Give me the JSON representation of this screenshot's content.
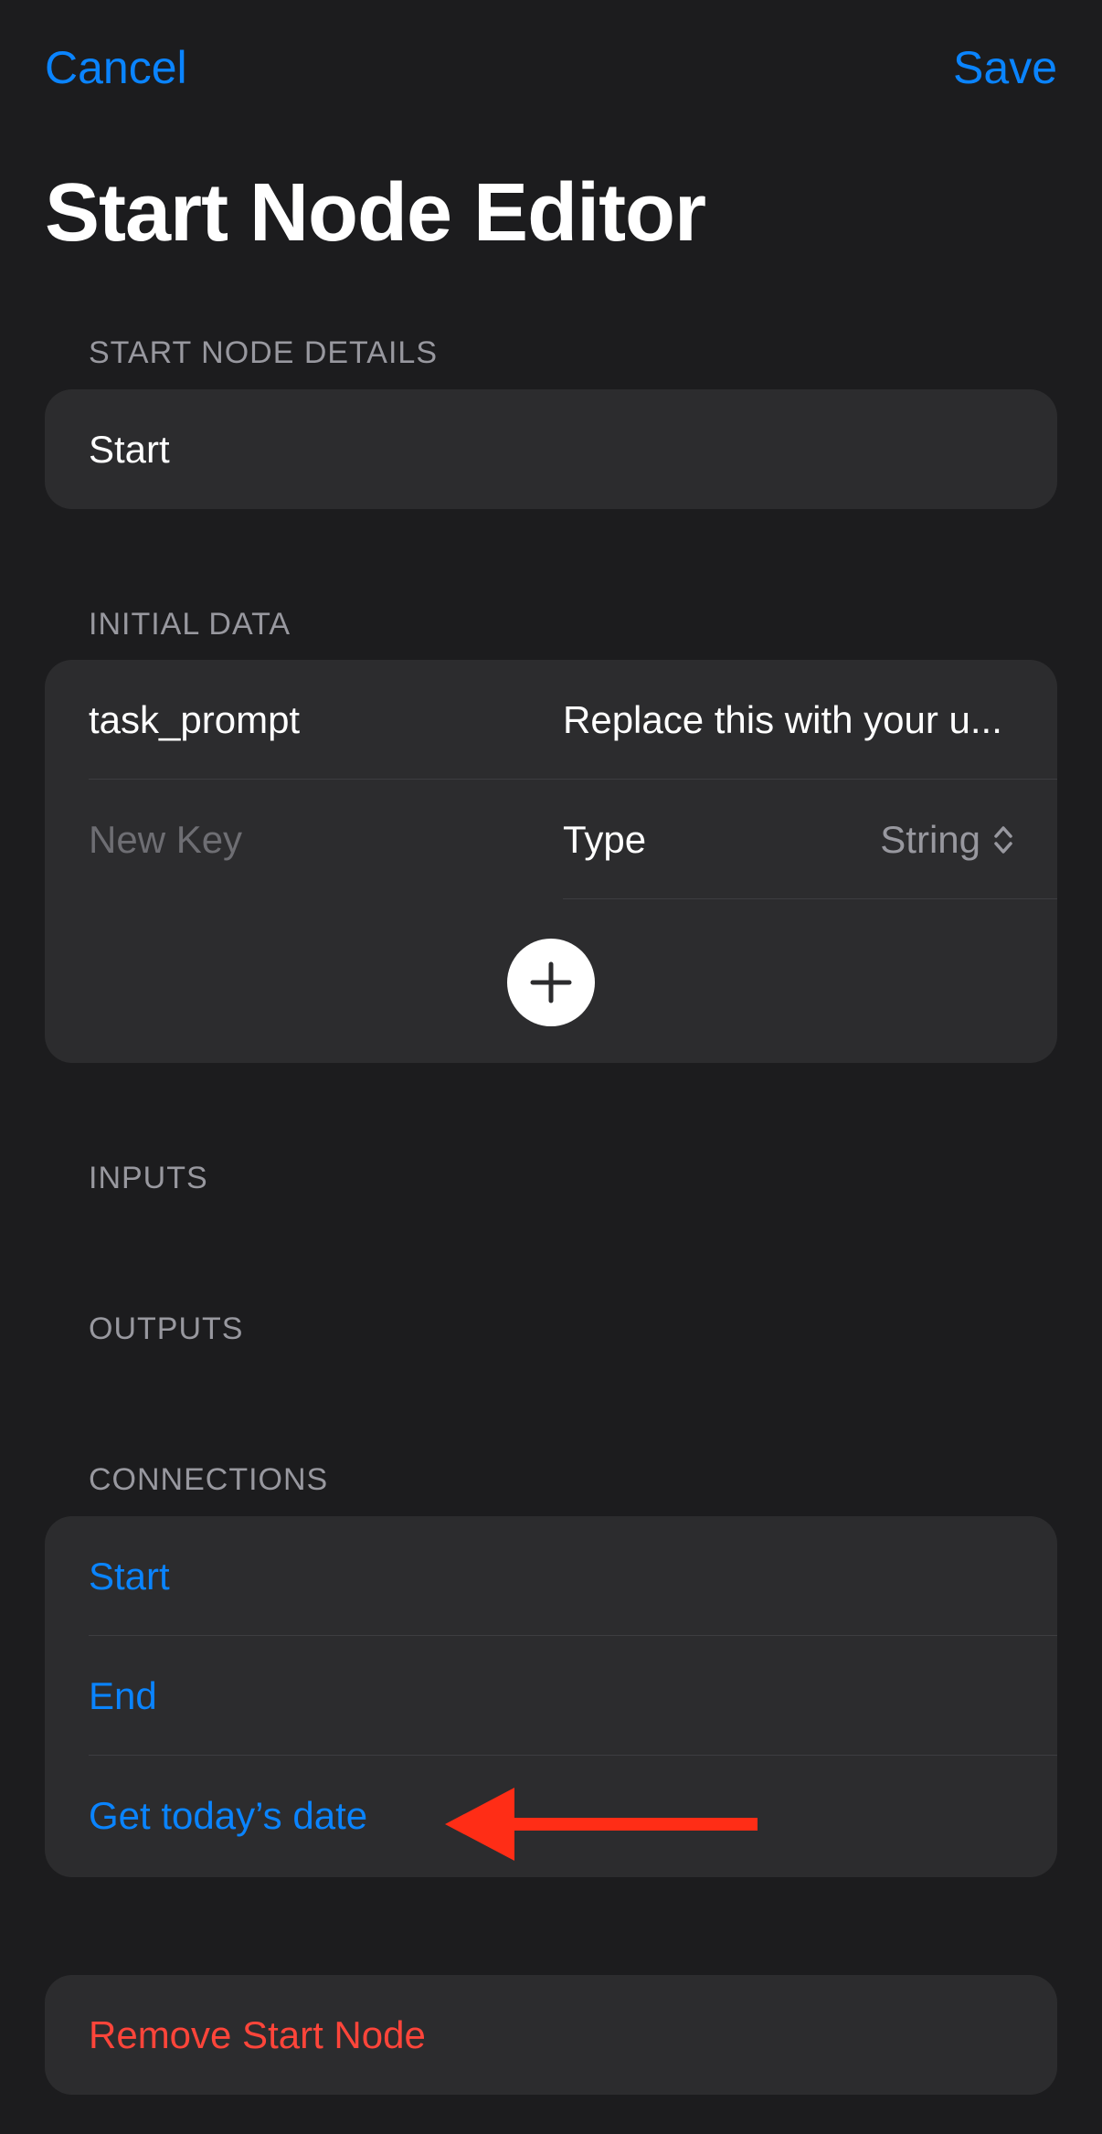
{
  "nav": {
    "cancel_label": "Cancel",
    "save_label": "Save"
  },
  "page_title": "Start Node Editor",
  "start_node_details": {
    "header": "START NODE DETAILS",
    "name_value": "Start"
  },
  "initial_data": {
    "header": "INITIAL DATA",
    "entries": [
      {
        "key": "task_prompt",
        "value": "Replace this with your u..."
      }
    ],
    "new_entry": {
      "key_placeholder": "New Key",
      "type_label": "Type",
      "type_value": "String"
    },
    "add_icon": "plus-circle-icon"
  },
  "inputs": {
    "header": "INPUTS"
  },
  "outputs": {
    "header": "OUTPUTS"
  },
  "connections": {
    "header": "CONNECTIONS",
    "items": [
      {
        "label": "Start"
      },
      {
        "label": "End"
      },
      {
        "label": "Get today’s date"
      }
    ]
  },
  "remove_button_label": "Remove Start Node",
  "colors": {
    "background": "#1c1c1e",
    "card": "#2c2c2e",
    "accent_blue": "#0a84ff",
    "destructive_red": "#ff453a",
    "annotation_arrow": "#ff2d16",
    "secondary_text": "#98989f"
  }
}
